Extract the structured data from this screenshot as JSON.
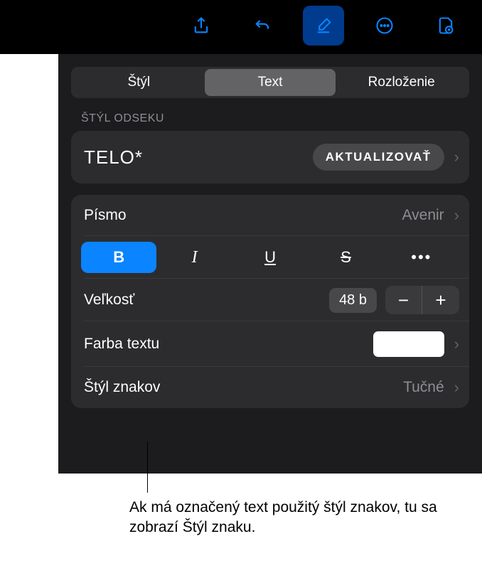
{
  "toolbar": {
    "icons": [
      "share-icon",
      "undo-icon",
      "format-brush-icon",
      "more-icon",
      "document-icon"
    ]
  },
  "tabs": {
    "items": [
      "Štýl",
      "Text",
      "Rozloženie"
    ],
    "activeIndex": 1
  },
  "paragraphStyle": {
    "sectionLabel": "ŠTÝL ODSEKU",
    "name": "TELO*",
    "updateLabel": "AKTUALIZOVAŤ"
  },
  "font": {
    "label": "Písmo",
    "value": "Avenir"
  },
  "formatButtons": {
    "bold": "B",
    "italic": "I",
    "underline": "U",
    "strike": "S",
    "more": "•••"
  },
  "size": {
    "label": "Veľkosť",
    "value": "48 b"
  },
  "textColor": {
    "label": "Farba textu",
    "value": "#ffffff"
  },
  "charStyle": {
    "label": "Štýl znakov",
    "value": "Tučné"
  },
  "callout": {
    "text": "Ak má označený text použitý štýl znakov, tu sa zobrazí Štýl znaku."
  }
}
